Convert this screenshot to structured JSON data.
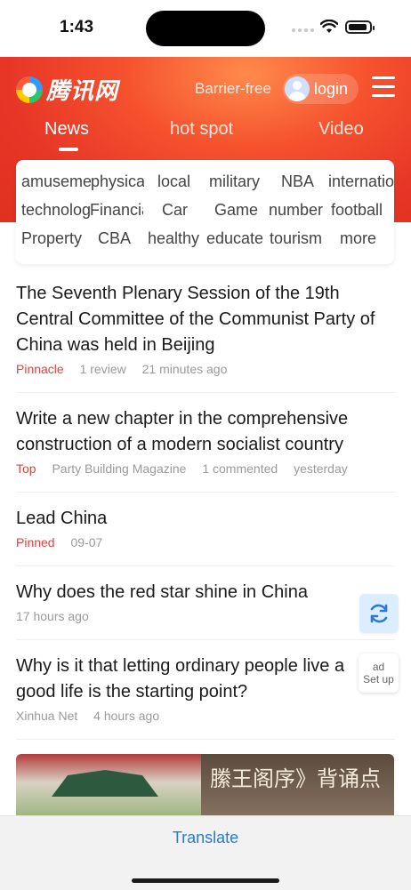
{
  "status": {
    "time": "1:43"
  },
  "header": {
    "logo_text": "腾讯网",
    "barrier_free": "Barrier-free",
    "login": "login",
    "tabs": [
      {
        "label": "News"
      },
      {
        "label": "hot spot"
      },
      {
        "label": "Video"
      }
    ]
  },
  "channels": {
    "rows": [
      [
        "amusement",
        "physical",
        "local",
        "military",
        "NBA",
        "international"
      ],
      [
        "technology",
        "Financial",
        "Car",
        "Game",
        "number",
        "football"
      ],
      [
        "Property",
        "CBA",
        "healthy",
        "educate",
        "tourism",
        "more"
      ]
    ]
  },
  "news": [
    {
      "title": "The Seventh Plenary Session of the 19th Central Committee of the Communist Party of China was held in Beijing",
      "tag": "Pinnacle",
      "meta1": "1 review",
      "meta2": "21 minutes ago"
    },
    {
      "title": "Write a new chapter in the comprehensive construction of a modern socialist country",
      "tag": "Top",
      "meta1": "Party Building Magazine",
      "meta2": "1 commented",
      "meta3": "yesterday"
    },
    {
      "title": "Lead China",
      "tag": "Pinned",
      "meta1": "09-07"
    },
    {
      "title": "Why does the red star shine in China",
      "meta1": "17 hours ago"
    },
    {
      "title": "Why is it that letting ordinary people live a good life is the starting point?",
      "meta1": "Xinhua Net",
      "meta2": "4 hours ago"
    }
  ],
  "ad": {
    "line1": "ad",
    "line2": "Set up"
  },
  "image": {
    "caption": "縢王阁序》背诵点"
  },
  "bottom": {
    "translate": "Translate"
  },
  "colors": {
    "accent_red": "#e73526",
    "tag_red": "#e2403a",
    "link_blue": "#2a7ad8"
  }
}
